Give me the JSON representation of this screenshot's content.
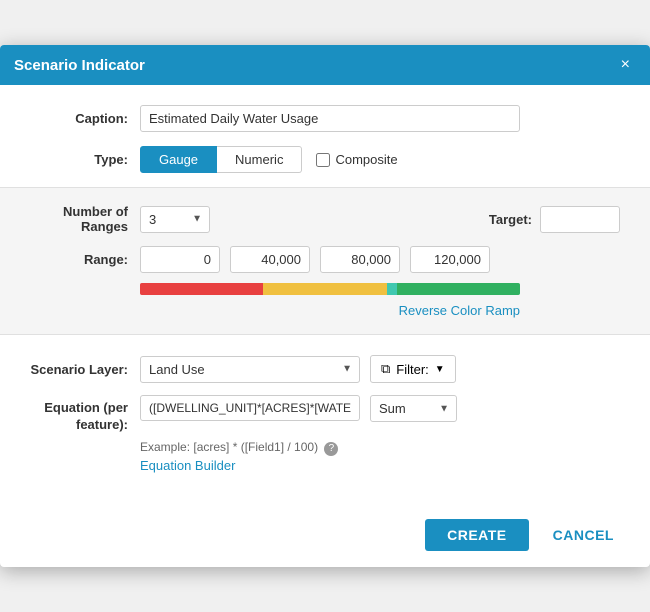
{
  "dialog": {
    "title": "Scenario Indicator",
    "close_label": "×"
  },
  "form": {
    "caption_label": "Caption:",
    "caption_value": "Estimated Daily Water Usage",
    "caption_placeholder": "",
    "type_label": "Type:",
    "btn_gauge": "Gauge",
    "btn_numeric": "Numeric",
    "composite_label": "Composite",
    "ranges_label": "Number of Ranges",
    "ranges_value": "3",
    "target_label": "Target:",
    "target_value": "",
    "range_label": "Range:",
    "range_values": [
      "0",
      "40,000",
      "80,000",
      "120,000"
    ],
    "reverse_color_ramp": "Reverse Color Ramp",
    "scenario_layer_label": "Scenario Layer:",
    "scenario_layer_value": "Land Use",
    "filter_label": "Filter:",
    "equation_label": "Equation (per feature):",
    "equation_value": "([DWELLING_UNIT]*[ACRES]*[WATE",
    "sum_label": "Sum",
    "equation_example": "Example: [acres] * ([Field1] / 100)",
    "equation_builder": "Equation Builder",
    "help_icon": "?"
  },
  "footer": {
    "create_label": "CREATE",
    "cancel_label": "CANCEL"
  }
}
